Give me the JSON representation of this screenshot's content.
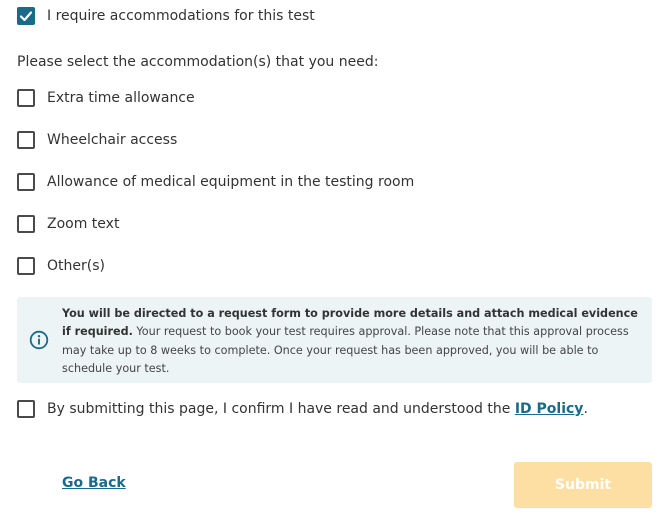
{
  "require_accommodations": {
    "label": "I require accommodations for this test",
    "checked": true
  },
  "prompt": "Please select the accommodation(s) that you need:",
  "accommodations": [
    {
      "label": "Extra time allowance",
      "checked": false
    },
    {
      "label": "Wheelchair access",
      "checked": false
    },
    {
      "label": "Allowance of medical equipment in the testing room",
      "checked": false
    },
    {
      "label": "Zoom text",
      "checked": false
    },
    {
      "label": "Other(s)",
      "checked": false
    }
  ],
  "info": {
    "icon": "info-icon",
    "bold_text": "You will be directed to a request form to provide more details and attach medical evidence if required.",
    "body_text": " Your request to book your test requires approval. Please note that this approval process may take up to 8 weeks to complete. Once your request has been approved, you will be able to schedule your test."
  },
  "confirm": {
    "label_before": "By submitting this page, I confirm I have read and understood the ",
    "link": "ID Policy",
    "label_after": ".",
    "checked": false
  },
  "actions": {
    "back_label": "Go Back",
    "submit_label": "Submit",
    "submit_enabled": false
  },
  "colors": {
    "accent": "#1c6a8a",
    "info_bg": "#edf4f6",
    "submit_disabled_bg": "#fddea3"
  }
}
